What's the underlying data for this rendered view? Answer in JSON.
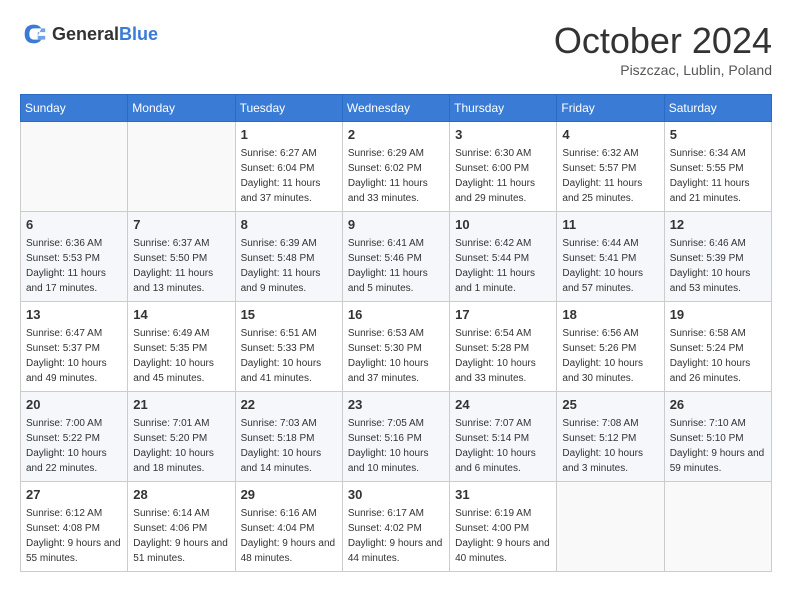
{
  "header": {
    "logo_general": "General",
    "logo_blue": "Blue",
    "title": "October 2024",
    "location": "Piszczac, Lublin, Poland"
  },
  "weekdays": [
    "Sunday",
    "Monday",
    "Tuesday",
    "Wednesday",
    "Thursday",
    "Friday",
    "Saturday"
  ],
  "weeks": [
    [
      {
        "day": "",
        "info": ""
      },
      {
        "day": "",
        "info": ""
      },
      {
        "day": "1",
        "info": "Sunrise: 6:27 AM\nSunset: 6:04 PM\nDaylight: 11 hours and 37 minutes."
      },
      {
        "day": "2",
        "info": "Sunrise: 6:29 AM\nSunset: 6:02 PM\nDaylight: 11 hours and 33 minutes."
      },
      {
        "day": "3",
        "info": "Sunrise: 6:30 AM\nSunset: 6:00 PM\nDaylight: 11 hours and 29 minutes."
      },
      {
        "day": "4",
        "info": "Sunrise: 6:32 AM\nSunset: 5:57 PM\nDaylight: 11 hours and 25 minutes."
      },
      {
        "day": "5",
        "info": "Sunrise: 6:34 AM\nSunset: 5:55 PM\nDaylight: 11 hours and 21 minutes."
      }
    ],
    [
      {
        "day": "6",
        "info": "Sunrise: 6:36 AM\nSunset: 5:53 PM\nDaylight: 11 hours and 17 minutes."
      },
      {
        "day": "7",
        "info": "Sunrise: 6:37 AM\nSunset: 5:50 PM\nDaylight: 11 hours and 13 minutes."
      },
      {
        "day": "8",
        "info": "Sunrise: 6:39 AM\nSunset: 5:48 PM\nDaylight: 11 hours and 9 minutes."
      },
      {
        "day": "9",
        "info": "Sunrise: 6:41 AM\nSunset: 5:46 PM\nDaylight: 11 hours and 5 minutes."
      },
      {
        "day": "10",
        "info": "Sunrise: 6:42 AM\nSunset: 5:44 PM\nDaylight: 11 hours and 1 minute."
      },
      {
        "day": "11",
        "info": "Sunrise: 6:44 AM\nSunset: 5:41 PM\nDaylight: 10 hours and 57 minutes."
      },
      {
        "day": "12",
        "info": "Sunrise: 6:46 AM\nSunset: 5:39 PM\nDaylight: 10 hours and 53 minutes."
      }
    ],
    [
      {
        "day": "13",
        "info": "Sunrise: 6:47 AM\nSunset: 5:37 PM\nDaylight: 10 hours and 49 minutes."
      },
      {
        "day": "14",
        "info": "Sunrise: 6:49 AM\nSunset: 5:35 PM\nDaylight: 10 hours and 45 minutes."
      },
      {
        "day": "15",
        "info": "Sunrise: 6:51 AM\nSunset: 5:33 PM\nDaylight: 10 hours and 41 minutes."
      },
      {
        "day": "16",
        "info": "Sunrise: 6:53 AM\nSunset: 5:30 PM\nDaylight: 10 hours and 37 minutes."
      },
      {
        "day": "17",
        "info": "Sunrise: 6:54 AM\nSunset: 5:28 PM\nDaylight: 10 hours and 33 minutes."
      },
      {
        "day": "18",
        "info": "Sunrise: 6:56 AM\nSunset: 5:26 PM\nDaylight: 10 hours and 30 minutes."
      },
      {
        "day": "19",
        "info": "Sunrise: 6:58 AM\nSunset: 5:24 PM\nDaylight: 10 hours and 26 minutes."
      }
    ],
    [
      {
        "day": "20",
        "info": "Sunrise: 7:00 AM\nSunset: 5:22 PM\nDaylight: 10 hours and 22 minutes."
      },
      {
        "day": "21",
        "info": "Sunrise: 7:01 AM\nSunset: 5:20 PM\nDaylight: 10 hours and 18 minutes."
      },
      {
        "day": "22",
        "info": "Sunrise: 7:03 AM\nSunset: 5:18 PM\nDaylight: 10 hours and 14 minutes."
      },
      {
        "day": "23",
        "info": "Sunrise: 7:05 AM\nSunset: 5:16 PM\nDaylight: 10 hours and 10 minutes."
      },
      {
        "day": "24",
        "info": "Sunrise: 7:07 AM\nSunset: 5:14 PM\nDaylight: 10 hours and 6 minutes."
      },
      {
        "day": "25",
        "info": "Sunrise: 7:08 AM\nSunset: 5:12 PM\nDaylight: 10 hours and 3 minutes."
      },
      {
        "day": "26",
        "info": "Sunrise: 7:10 AM\nSunset: 5:10 PM\nDaylight: 9 hours and 59 minutes."
      }
    ],
    [
      {
        "day": "27",
        "info": "Sunrise: 6:12 AM\nSunset: 4:08 PM\nDaylight: 9 hours and 55 minutes."
      },
      {
        "day": "28",
        "info": "Sunrise: 6:14 AM\nSunset: 4:06 PM\nDaylight: 9 hours and 51 minutes."
      },
      {
        "day": "29",
        "info": "Sunrise: 6:16 AM\nSunset: 4:04 PM\nDaylight: 9 hours and 48 minutes."
      },
      {
        "day": "30",
        "info": "Sunrise: 6:17 AM\nSunset: 4:02 PM\nDaylight: 9 hours and 44 minutes."
      },
      {
        "day": "31",
        "info": "Sunrise: 6:19 AM\nSunset: 4:00 PM\nDaylight: 9 hours and 40 minutes."
      },
      {
        "day": "",
        "info": ""
      },
      {
        "day": "",
        "info": ""
      }
    ]
  ]
}
